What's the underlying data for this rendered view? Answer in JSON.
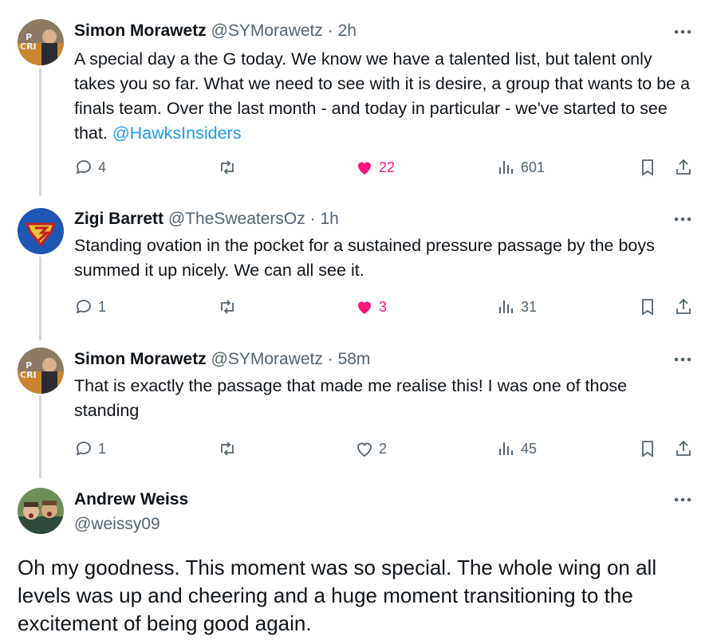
{
  "tweets": [
    {
      "name": "Simon Morawetz",
      "handle": "@SYMorawetz",
      "dot": "·",
      "time": "2h",
      "text": "A special day a the G today. We know we have a talented list, but talent only takes you so far. What we need to see with it is desire, a group that wants to be a finals team. Over the last month - and today in particular - we've started to see that.",
      "mention": "@HawksInsiders",
      "replies": "4",
      "likes": "22",
      "views": "601",
      "liked": true
    },
    {
      "name": "Zigi Barrett",
      "handle": "@TheSweatersOz",
      "dot": "·",
      "time": "1h",
      "text": "Standing ovation in the pocket for a sustained pressure passage by the boys summed it up nicely. We can all see it.",
      "replies": "1",
      "likes": "3",
      "views": "31",
      "liked": true
    },
    {
      "name": "Simon Morawetz",
      "handle": "@SYMorawetz",
      "dot": "·",
      "time": "58m",
      "text": "That is exactly the passage that made me realise this! I was one of those standing",
      "replies": "1",
      "likes": "2",
      "views": "45",
      "liked": false
    }
  ],
  "main_tweet": {
    "name": "Andrew Weiss",
    "handle": "@weissy09",
    "text": "Oh my goodness. This moment was so special. The whole wing on all levels was up and cheering and a huge moment transitioning to the excitement of being good again."
  },
  "colors": {
    "like": "#f91880",
    "link": "#1d9bf0",
    "muted": "#536471",
    "line": "#cfd9de"
  },
  "icons": [
    "reply-icon",
    "retweet-icon",
    "heart-icon",
    "views-icon",
    "bookmark-icon",
    "share-icon",
    "more-icon"
  ]
}
